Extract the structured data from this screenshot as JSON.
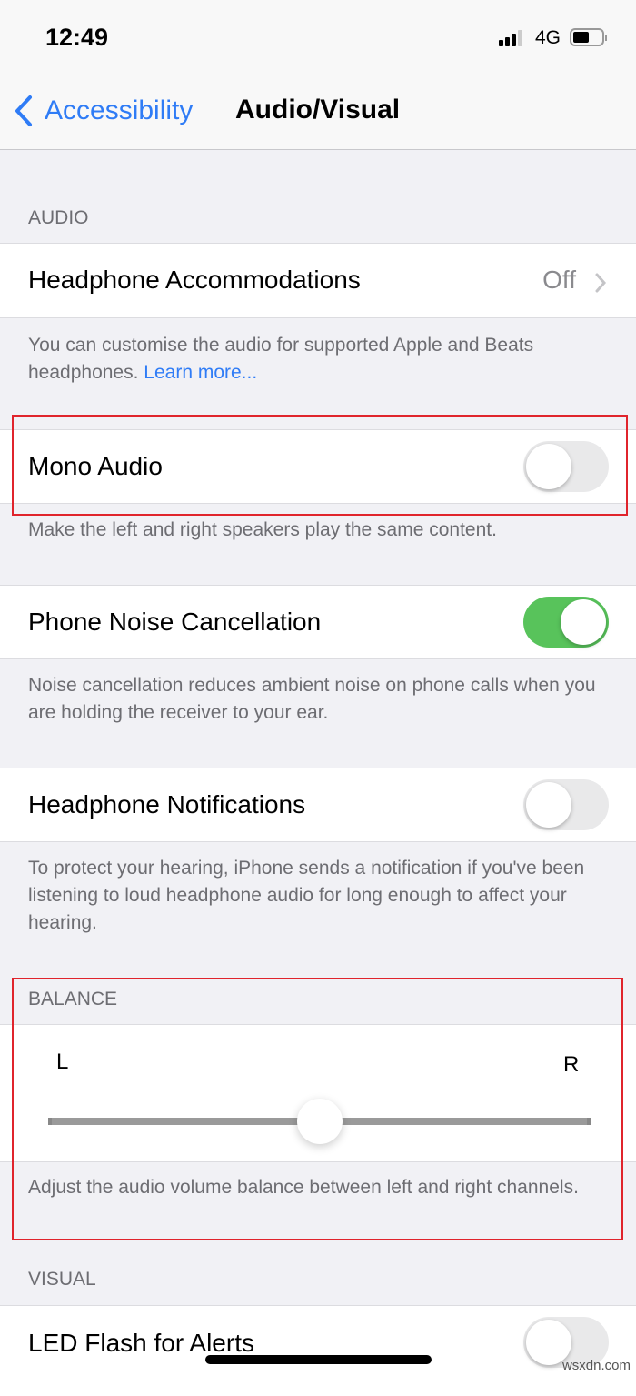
{
  "status_bar": {
    "time": "12:49",
    "network": "4G",
    "signal_bars": 3,
    "battery_level": 0.5
  },
  "nav": {
    "back_label": "Accessibility",
    "title": "Audio/Visual"
  },
  "audio": {
    "header": "AUDIO",
    "headphone_accommodations": {
      "label": "Headphone Accommodations",
      "value": "Off"
    },
    "headphone_accommodations_footer": "You can customise the audio for supported Apple and Beats headphones. ",
    "learn_more": "Learn more...",
    "mono_audio": {
      "label": "Mono Audio",
      "on": false,
      "footer": "Make the left and right speakers play the same content."
    },
    "phone_noise": {
      "label": "Phone Noise Cancellation",
      "on": true,
      "footer": "Noise cancellation reduces ambient noise on phone calls when you are holding the receiver to your ear."
    },
    "headphone_notifications": {
      "label": "Headphone Notifications",
      "on": false,
      "footer": "To protect your hearing, iPhone sends a notification if you've been listening to loud headphone audio for long enough to affect your hearing."
    }
  },
  "balance": {
    "header": "BALANCE",
    "left_label": "L",
    "right_label": "R",
    "value": 0.5,
    "footer": "Adjust the audio volume balance between left and right channels."
  },
  "visual": {
    "header": "VISUAL",
    "led_flash": {
      "label": "LED Flash for Alerts",
      "on": false
    }
  },
  "colors": {
    "accent": "#2f7cf6",
    "toggle_on": "#58c35b",
    "highlight": "#e0242c"
  },
  "watermark": "wsxdn.com"
}
